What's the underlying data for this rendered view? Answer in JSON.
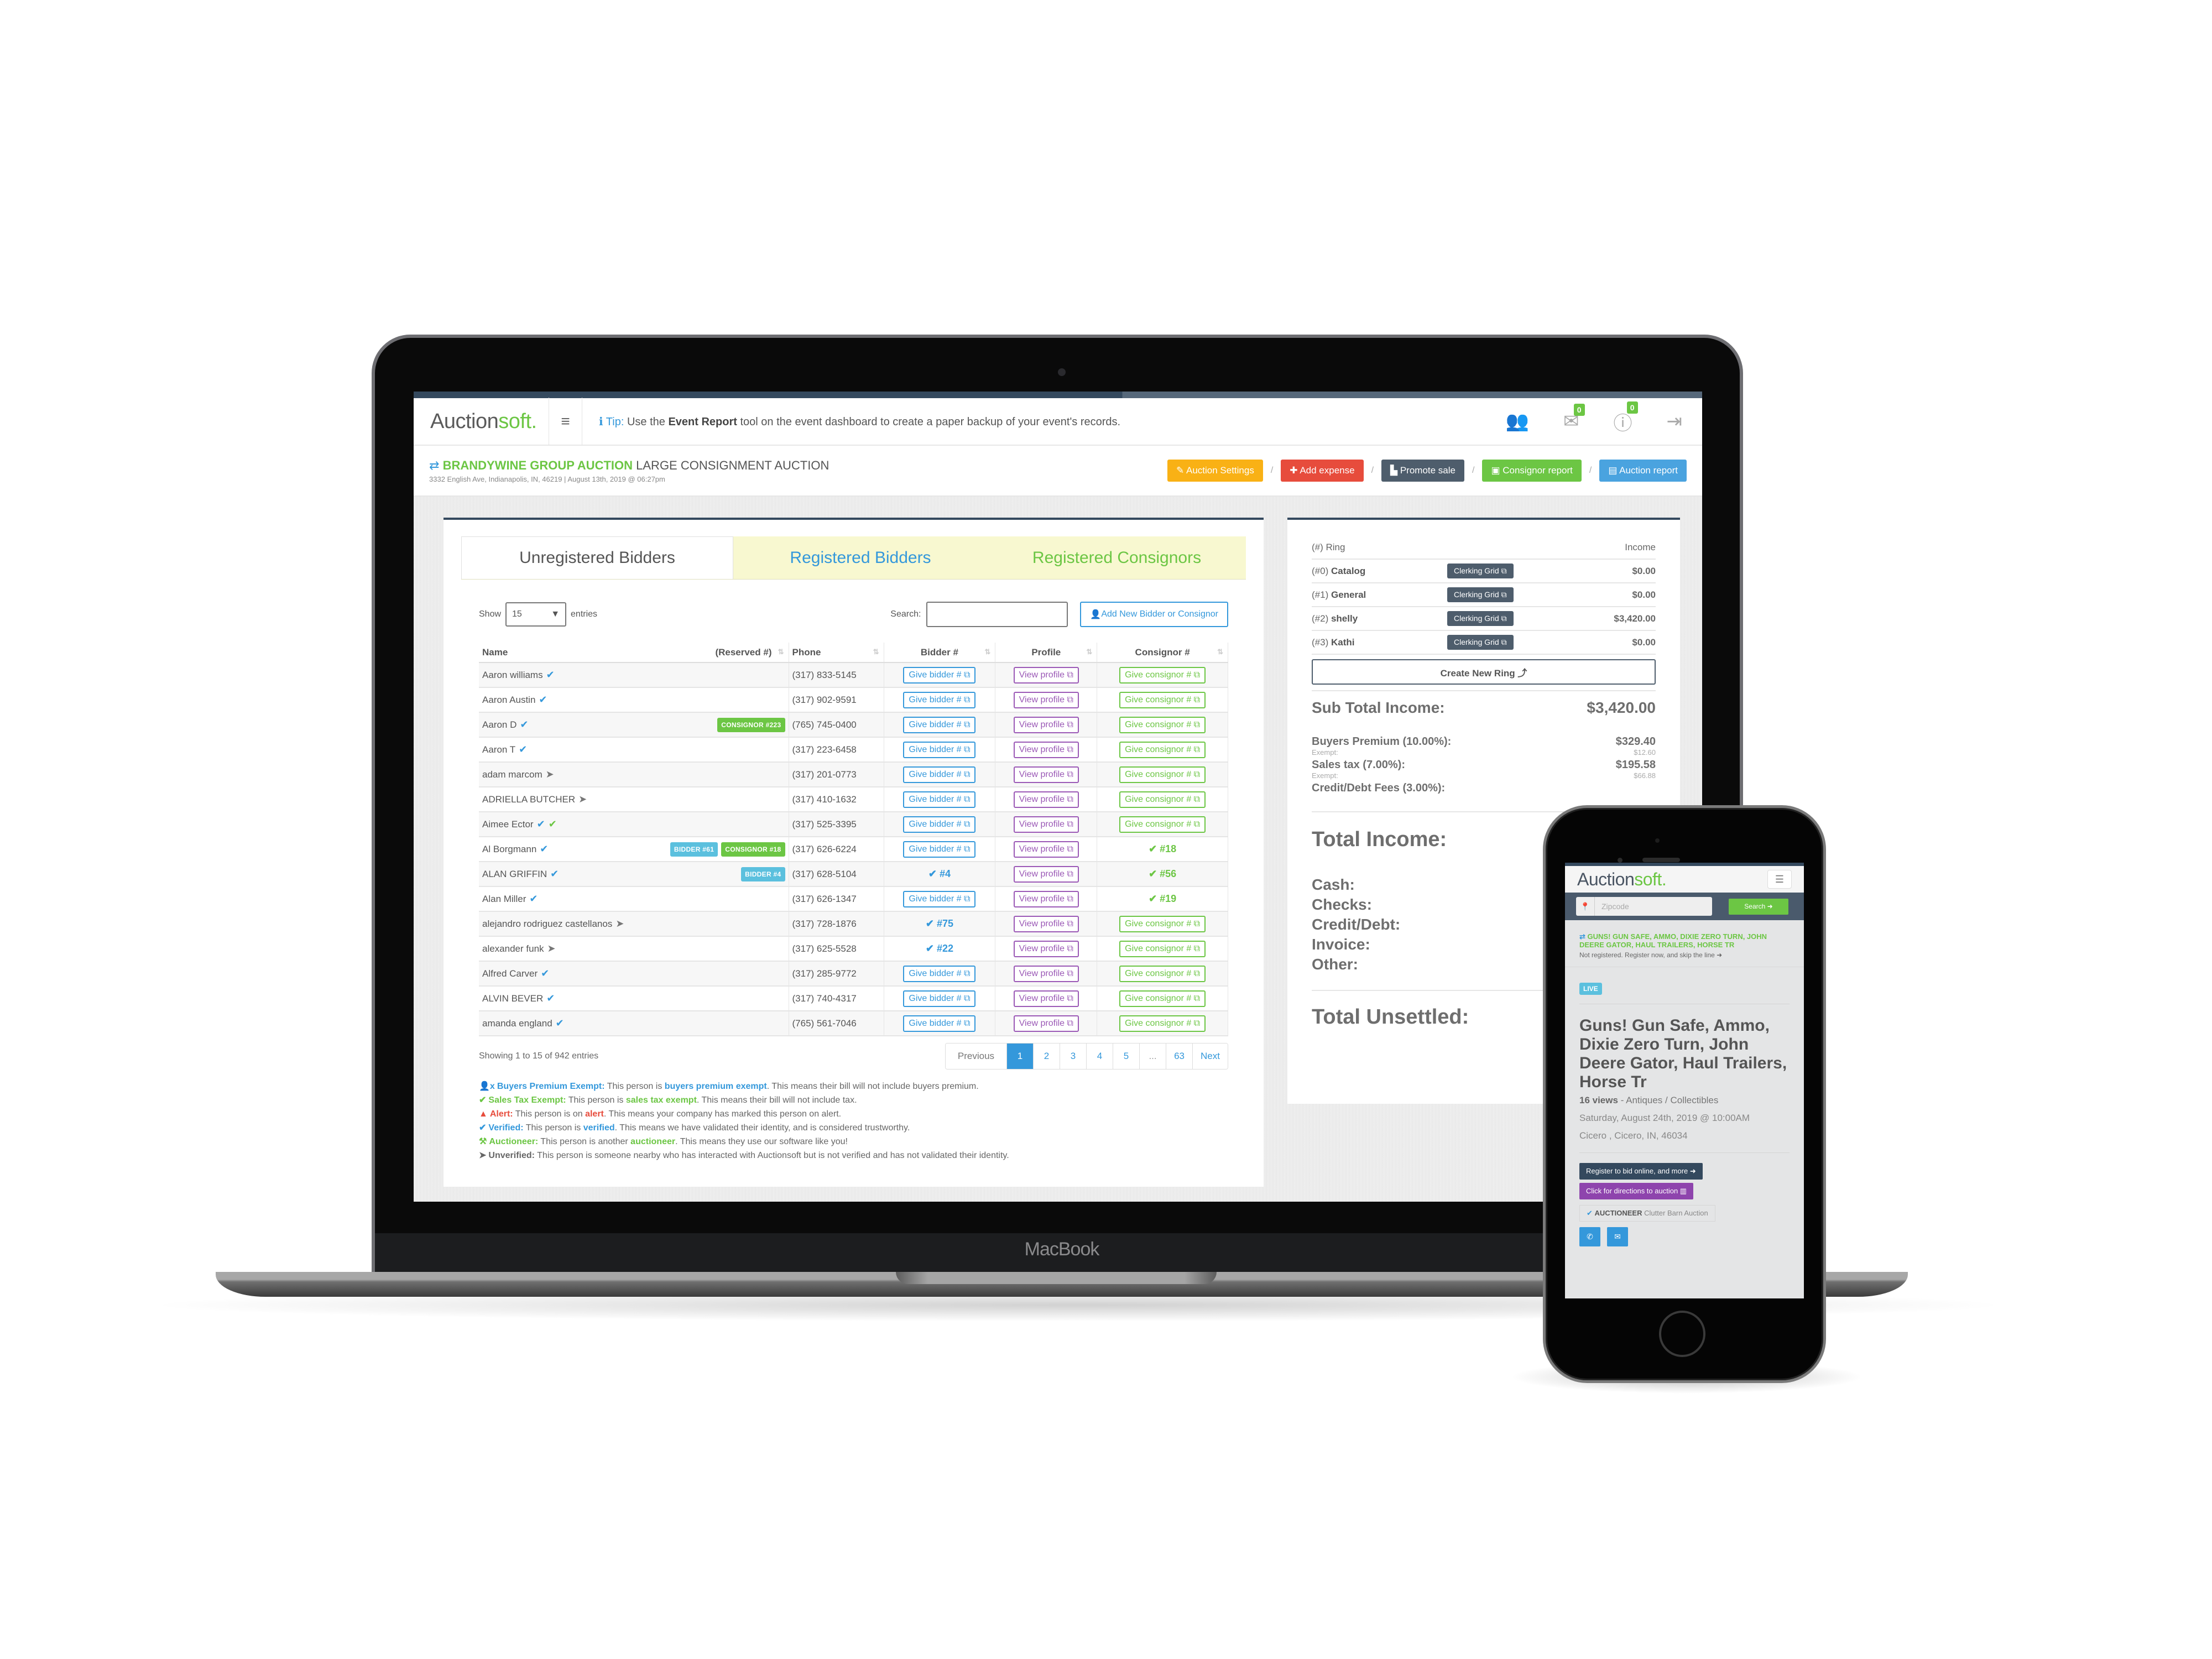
{
  "device": {
    "laptop_brand": "MacBook"
  },
  "app": {
    "logo_main": "Auction",
    "logo_accent": "soft.",
    "menu_icon": "hamburger-icon",
    "tip": {
      "label": "Tip:",
      "prefix": "Use the",
      "bold": "Event Report",
      "suffix": "tool on the event dashboard to create a paper backup of your event's records."
    },
    "header_icons": [
      {
        "name": "users-icon",
        "glyph": "👥",
        "badge": null
      },
      {
        "name": "mail-icon",
        "glyph": "✉",
        "badge": "0"
      },
      {
        "name": "alert-icon",
        "glyph": "ⓘ",
        "badge": "0"
      },
      {
        "name": "logout-icon",
        "glyph": "⇥",
        "badge": null
      }
    ]
  },
  "event": {
    "org": "BRANDYWINE GROUP AUCTION",
    "name": "LARGE CONSIGNMENT AUCTION",
    "subtitle": "3332 English Ave, Indianapolis, IN, 46219 | August 13th, 2019 @ 06:27pm",
    "actions": [
      {
        "label": "✎ Auction Settings",
        "color": "#f9b115"
      },
      {
        "label": "✚ Add expense",
        "color": "#e74c3c"
      },
      {
        "label": "▙ Promote sale",
        "color": "#4e5d6c"
      },
      {
        "label": "▣ Consignor report",
        "color": "#6cc644"
      },
      {
        "label": "▤ Auction report",
        "color": "#4aa3df"
      }
    ],
    "separator": "/"
  },
  "bidders_panel": {
    "tabs": [
      "Unregistered Bidders",
      "Registered Bidders",
      "Registered Consignors"
    ],
    "active_tab": "Unregistered Bidders",
    "show_label": "Show",
    "entries_label": "entries",
    "page_size": "15",
    "search_label": "Search:",
    "search_value": "",
    "add_button": "Add New Bidder or Consignor",
    "columns": [
      "Name",
      "(Reserved #)",
      "Phone",
      "Bidder #",
      "Profile",
      "Consignor #"
    ],
    "button_labels": {
      "give_bidder": "Give bidder # ⧉",
      "view_profile": "View profile ⧉",
      "give_consignor": "Give consignor # ⧉"
    },
    "rows": [
      {
        "name": "Aaron williams",
        "status": [
          "verified"
        ],
        "tags": [],
        "phone": "(317) 833-5145",
        "bidder": null,
        "consignor": null
      },
      {
        "name": "Aaron Austin",
        "status": [
          "verified"
        ],
        "tags": [],
        "phone": "(317) 902-9591",
        "bidder": null,
        "consignor": null
      },
      {
        "name": "Aaron D",
        "status": [
          "verified"
        ],
        "tags": [
          {
            "type": "consignor",
            "label": "CONSIGNOR #223"
          }
        ],
        "phone": "(765) 745-0400",
        "bidder": null,
        "consignor": null
      },
      {
        "name": "Aaron T",
        "status": [
          "verified"
        ],
        "tags": [],
        "phone": "(317) 223-6458",
        "bidder": null,
        "consignor": null
      },
      {
        "name": "adam marcom",
        "status": [
          "unverified"
        ],
        "tags": [],
        "phone": "(317) 201-0773",
        "bidder": null,
        "consignor": null
      },
      {
        "name": "ADRIELLA BUTCHER",
        "status": [
          "unverified"
        ],
        "tags": [],
        "phone": "(317) 410-1632",
        "bidder": null,
        "consignor": null
      },
      {
        "name": "Aimee Ector",
        "status": [
          "verified",
          "tax"
        ],
        "tags": [],
        "phone": "(317) 525-3395",
        "bidder": null,
        "consignor": null
      },
      {
        "name": "Al Borgmann",
        "status": [
          "verified"
        ],
        "tags": [
          {
            "type": "bidder",
            "label": "BIDDER #61"
          },
          {
            "type": "consignor",
            "label": "CONSIGNOR #18"
          }
        ],
        "phone": "(317) 626-6224",
        "bidder": null,
        "consignor": "#18"
      },
      {
        "name": "ALAN GRIFFIN",
        "status": [
          "verified"
        ],
        "tags": [
          {
            "type": "bidder",
            "label": "BIDDER #4"
          }
        ],
        "phone": "(317) 628-5104",
        "bidder": "#4",
        "consignor": "#56"
      },
      {
        "name": "Alan Miller",
        "status": [
          "verified"
        ],
        "tags": [],
        "phone": "(317) 626-1347",
        "bidder": null,
        "consignor": "#19"
      },
      {
        "name": "alejandro rodriguez castellanos",
        "status": [
          "unverified"
        ],
        "tags": [],
        "phone": "(317) 728-1876",
        "bidder": "#75",
        "consignor": null
      },
      {
        "name": "alexander funk",
        "status": [
          "unverified"
        ],
        "tags": [],
        "phone": "(317) 625-5528",
        "bidder": "#22",
        "consignor": null
      },
      {
        "name": "Alfred Carver",
        "status": [
          "verified"
        ],
        "tags": [],
        "phone": "(317) 285-9772",
        "bidder": null,
        "consignor": null
      },
      {
        "name": "ALVIN BEVER",
        "status": [
          "verified"
        ],
        "tags": [],
        "phone": "(317) 740-4317",
        "bidder": null,
        "consignor": null
      },
      {
        "name": "amanda england",
        "status": [
          "verified"
        ],
        "tags": [],
        "phone": "(765) 561-7046",
        "bidder": null,
        "consignor": null
      }
    ],
    "showing": "Showing 1 to 15 of 942 entries",
    "pagination": {
      "previous": "Previous",
      "pages": [
        "1",
        "2",
        "3",
        "4",
        "5",
        "...",
        "63"
      ],
      "current": "1",
      "next": "Next"
    },
    "legend": [
      {
        "icon": "👤x",
        "color": "blue",
        "term": "Buyers Premium Exempt:",
        "pre": "This person is",
        "highlight": "buyers premium exempt",
        "post": ". This means their bill will not include buyers premium."
      },
      {
        "icon": "✔",
        "color": "green",
        "term": "Sales Tax Exempt:",
        "pre": "This person is",
        "highlight": "sales tax exempt",
        "post": ". This means their bill will not include tax."
      },
      {
        "icon": "▲",
        "color": "red",
        "term": "Alert:",
        "pre": "This person is on",
        "highlight": "alert",
        "post": ". This means your company has marked this person on alert."
      },
      {
        "icon": "✔",
        "color": "blue",
        "term": "Verified:",
        "pre": "This person is",
        "highlight": "verified",
        "post": ". This means we have validated their identity, and is considered trustworthy."
      },
      {
        "icon": "⚒",
        "color": "green",
        "term": "Auctioneer:",
        "pre": "This person is another",
        "highlight": "auctioneer",
        "post": ". This means they use our software like you!"
      },
      {
        "icon": "➤",
        "color": "gray",
        "term": "Unverified:",
        "pre": "This person is someone nearby who has interacted with Auctionsoft but is not verified and has not validated their identity.",
        "highlight": "",
        "post": ""
      }
    ]
  },
  "income_panel": {
    "ring_header": "(#) Ring",
    "income_header": "Income",
    "clerk_label": "Clerking Grid ⧉",
    "rings": [
      {
        "num": "(#0)",
        "name": "Catalog",
        "income": "$0.00"
      },
      {
        "num": "(#1)",
        "name": "General",
        "income": "$0.00"
      },
      {
        "num": "(#2)",
        "name": "shelly",
        "income": "$3,420.00"
      },
      {
        "num": "(#3)",
        "name": "Kathi",
        "income": "$0.00"
      }
    ],
    "create_ring": "Create New Ring ⤴",
    "sub_total_label": "Sub Total Income:",
    "sub_total_value": "$3,420.00",
    "fees": [
      {
        "label": "Buyers Premium (10.00%):",
        "value": "$329.40",
        "exempt_label": "Exempt:",
        "exempt_value": "$12.60"
      },
      {
        "label": "Sales tax (7.00%):",
        "value": "$195.58",
        "exempt_label": "Exempt:",
        "exempt_value": "$66.88"
      },
      {
        "label": "Credit/Debt Fees (3.00%):",
        "value": "",
        "exempt_label": "",
        "exempt_value": ""
      }
    ],
    "total_income_label": "Total Income:",
    "payments": [
      "Cash:",
      "Checks:",
      "Credit/Debt:",
      "Invoice:",
      "Other:"
    ],
    "total_unsettled_label": "Total Unsettled:"
  },
  "mobile": {
    "logo_main": "Auction",
    "logo_accent": "soft.",
    "zip_placeholder": "Zipcode",
    "search_button": "Search ➜",
    "notice_title": "GUNS! GUN SAFE, AMMO, DIXIE ZERO TURN, JOHN DEERE GATOR, HAUL TRAILERS, HORSE TR",
    "notice_sub": "Not registered. Register now, and skip the line ➜",
    "badge": "LIVE",
    "title": "Guns! Gun Safe, Ammo, Dixie Zero Turn, John Deere Gator, Haul Trailers, Horse Tr",
    "views": "16 views",
    "category": "- Antiques / Collectibles",
    "date": "Saturday, August 24th, 2019 @ 10:00AM",
    "location": "Cicero , Cicero, IN, 46034",
    "register_button": "Register to bid online, and more ➜",
    "directions_button": "Click for directions to auction ▥",
    "auctioneer_label": "AUCTIONEER",
    "auctioneer_name": "Clutter Barn Auction"
  }
}
